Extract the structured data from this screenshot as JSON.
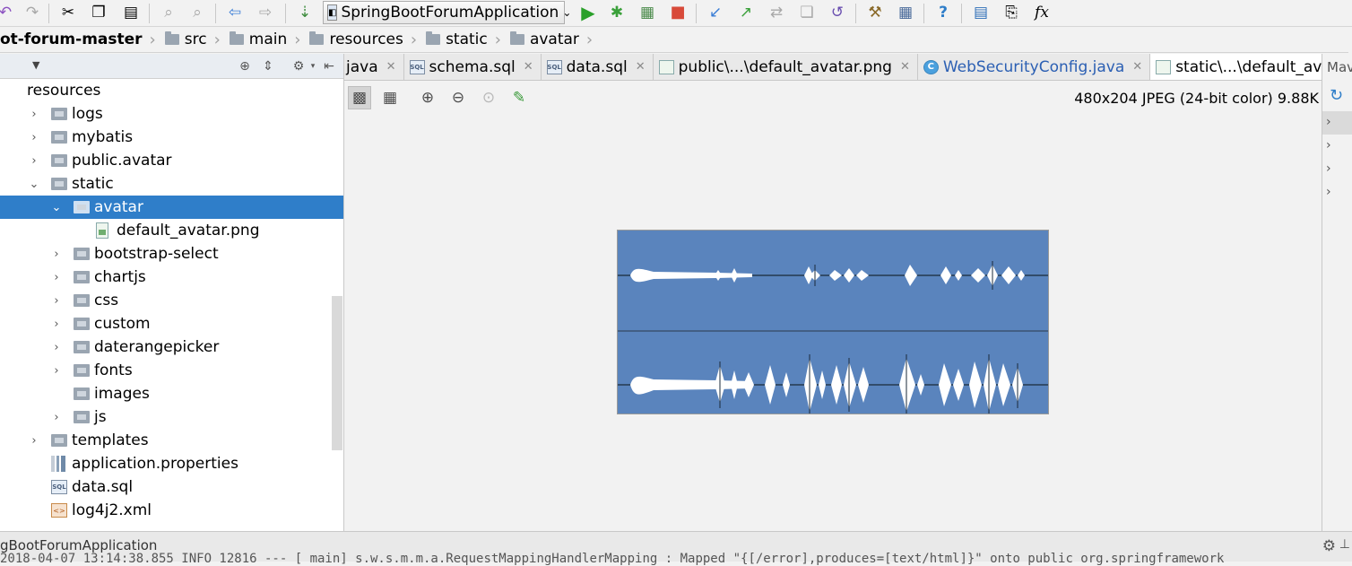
{
  "toolbar": {
    "run_config": "SpringBootForumApplication",
    "icons": [
      "cut-icon",
      "copy-icon",
      "paste-icon",
      "find-icon",
      "replace-icon",
      "back-icon",
      "forward-icon",
      "build-icon",
      "run-icon",
      "debug-icon",
      "coverage-icon",
      "stop-icon",
      "vcs-update-icon",
      "vcs-commit-icon",
      "vcs-compare-icon",
      "vcs-history-icon",
      "vcs-revert-icon",
      "settings-icon",
      "project-structure-icon",
      "help-icon",
      "tasks-icon",
      "terminal-icon",
      "evaluate-icon"
    ],
    "fx_label": "fx"
  },
  "breadcrumb": {
    "items": [
      "ot-forum-master",
      "src",
      "main",
      "resources",
      "static",
      "avatar"
    ]
  },
  "project_tree": {
    "rows": [
      {
        "label": "resources",
        "depth": 0,
        "kind": "resources",
        "expander": ""
      },
      {
        "label": "logs",
        "depth": 1,
        "kind": "dir",
        "expander": "›"
      },
      {
        "label": "mybatis",
        "depth": 1,
        "kind": "dir",
        "expander": "›"
      },
      {
        "label": "public.avatar",
        "depth": 1,
        "kind": "dir",
        "expander": "›"
      },
      {
        "label": "static",
        "depth": 1,
        "kind": "dir",
        "expander": "⌄"
      },
      {
        "label": "avatar",
        "depth": 2,
        "kind": "dir",
        "expander": "⌄",
        "selected": true
      },
      {
        "label": "default_avatar.png",
        "depth": 3,
        "kind": "img",
        "expander": ""
      },
      {
        "label": "bootstrap-select",
        "depth": 2,
        "kind": "dir",
        "expander": "›"
      },
      {
        "label": "chartjs",
        "depth": 2,
        "kind": "dir",
        "expander": "›"
      },
      {
        "label": "css",
        "depth": 2,
        "kind": "dir",
        "expander": "›"
      },
      {
        "label": "custom",
        "depth": 2,
        "kind": "dir",
        "expander": "›"
      },
      {
        "label": "daterangepicker",
        "depth": 2,
        "kind": "dir",
        "expander": "›"
      },
      {
        "label": "fonts",
        "depth": 2,
        "kind": "dir",
        "expander": "›"
      },
      {
        "label": "images",
        "depth": 2,
        "kind": "dir",
        "expander": ""
      },
      {
        "label": "js",
        "depth": 2,
        "kind": "dir",
        "expander": "›"
      },
      {
        "label": "templates",
        "depth": 1,
        "kind": "dir",
        "expander": "›"
      },
      {
        "label": "application.properties",
        "depth": 1,
        "kind": "props",
        "expander": ""
      },
      {
        "label": "data.sql",
        "depth": 1,
        "kind": "sql",
        "expander": ""
      },
      {
        "label": "log4j2.xml",
        "depth": 1,
        "kind": "xml",
        "expander": ""
      }
    ]
  },
  "editor_tabs": [
    {
      "label": "java",
      "icon": "",
      "kind": "java-partial"
    },
    {
      "label": "schema.sql",
      "icon": "SQL",
      "kind": "sql"
    },
    {
      "label": "data.sql",
      "icon": "SQL",
      "kind": "sql"
    },
    {
      "label": "public\\...\\default_avatar.png",
      "icon": "",
      "kind": "img"
    },
    {
      "label": "WebSecurityConfig.java",
      "icon": "C",
      "kind": "class"
    },
    {
      "label": "static\\...\\default_avatar.png",
      "icon": "",
      "kind": "img",
      "active": true
    }
  ],
  "image_viewer": {
    "info": "480x204 JPEG (24-bit color) 9.88K",
    "tools": [
      "checkerboard-icon",
      "grid-icon",
      "zoom-in-icon",
      "zoom-out-icon",
      "actual-size-icon",
      "color-picker-icon"
    ]
  },
  "maven": {
    "title": "Mav",
    "rows": [
      "›",
      "›",
      "›",
      "›"
    ]
  },
  "status": {
    "run_tab": "gBootForumApplication",
    "console": "2018-04-07 13:14:38.855  INFO 12816 ---  [           main] s.w.s.m.m.a.RequestMappingHandlerMapping : Mapped \"{[/error],produces=[text/html]}\" onto public org.springframework"
  }
}
